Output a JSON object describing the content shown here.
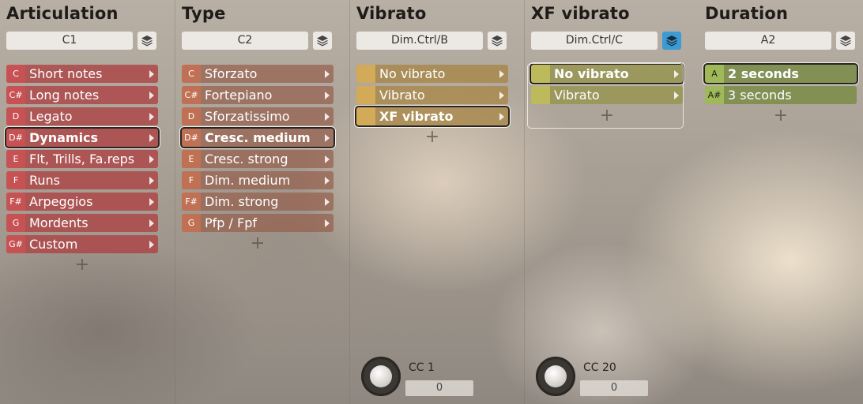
{
  "columns": [
    {
      "title": "Articulation",
      "selector": "C1",
      "layer_active": false,
      "items": [
        {
          "key": "C",
          "label": "Short notes"
        },
        {
          "key": "C#",
          "label": "Long notes"
        },
        {
          "key": "D",
          "label": "Legato"
        },
        {
          "key": "D#",
          "label": "Dynamics",
          "selected": true
        },
        {
          "key": "E",
          "label": "Flt, Trills, Fa.reps"
        },
        {
          "key": "F",
          "label": "Runs"
        },
        {
          "key": "F#",
          "label": "Arpeggios"
        },
        {
          "key": "G",
          "label": "Mordents"
        },
        {
          "key": "G#",
          "label": "Custom"
        }
      ]
    },
    {
      "title": "Type",
      "selector": "C2",
      "layer_active": false,
      "items": [
        {
          "key": "C",
          "label": "Sforzato"
        },
        {
          "key": "C#",
          "label": "Fortepiano"
        },
        {
          "key": "D",
          "label": "Sforzatissimo"
        },
        {
          "key": "D#",
          "label": "Cresc. medium",
          "selected": true
        },
        {
          "key": "E",
          "label": "Cresc. strong"
        },
        {
          "key": "F",
          "label": "Dim. medium"
        },
        {
          "key": "F#",
          "label": "Dim. strong"
        },
        {
          "key": "G",
          "label": "Pfp / Fpf"
        }
      ]
    },
    {
      "title": "Vibrato",
      "selector": "Dim.Ctrl/B",
      "layer_active": false,
      "items": [
        {
          "key": "",
          "label": "No vibrato"
        },
        {
          "key": "",
          "label": "Vibrato"
        },
        {
          "key": "",
          "label": "XF vibrato",
          "selected": true
        }
      ],
      "cc": {
        "label": "CC 1",
        "value": "0"
      }
    },
    {
      "title": "XF vibrato",
      "selector": "Dim.Ctrl/C",
      "layer_active": true,
      "items": [
        {
          "key": "",
          "label": "No vibrato",
          "selected": true
        },
        {
          "key": "",
          "label": "Vibrato"
        }
      ],
      "cc": {
        "label": "CC 20",
        "value": "0"
      }
    },
    {
      "title": "Duration",
      "selector": "A2",
      "layer_active": false,
      "items": [
        {
          "key": "A",
          "label": "2 seconds",
          "selected": true
        },
        {
          "key": "A#",
          "label": "3 seconds"
        }
      ]
    }
  ],
  "add_symbol": "+",
  "icons": {
    "layer": "layers-icon",
    "arrow": "triangle-right-icon",
    "add": "plus-icon"
  },
  "colors": {
    "accent_blue": "#3c9bd3",
    "articulation": "#ac4446",
    "type": "#c47052",
    "vibrato": "#d4ac58",
    "xf_vibrato": "#bebc5a",
    "duration": "#a0bc58"
  }
}
